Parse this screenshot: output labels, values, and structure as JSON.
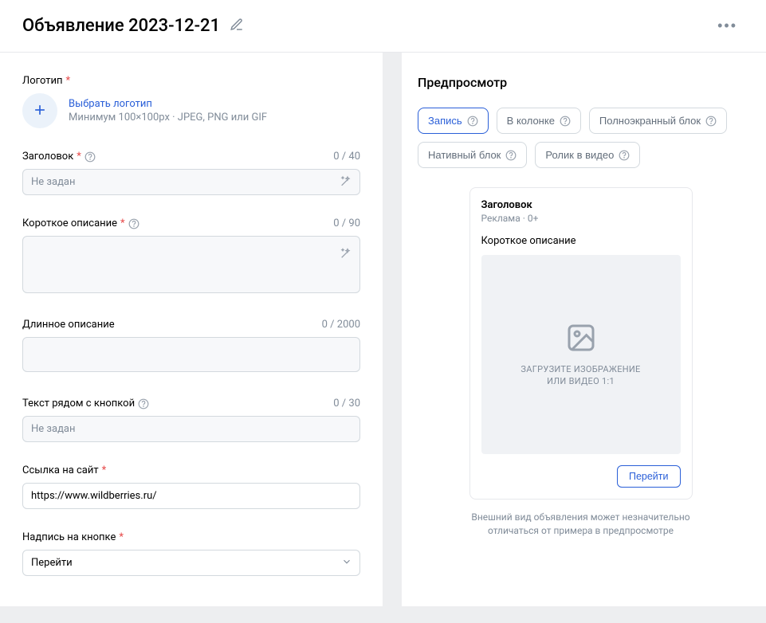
{
  "header": {
    "title": "Объявление 2023-12-21"
  },
  "form": {
    "logo": {
      "label": "Логотип",
      "link_text": "Выбрать логотип",
      "hint": "Минимум 100×100px · JPEG, PNG или GIF"
    },
    "heading": {
      "label": "Заголовок",
      "counter": "0 / 40",
      "placeholder": "Не задан"
    },
    "short_desc": {
      "label": "Короткое описание",
      "counter": "0 / 90"
    },
    "long_desc": {
      "label": "Длинное описание",
      "counter": "0 / 2000"
    },
    "button_text": {
      "label": "Текст рядом с кнопкой",
      "counter": "0 / 30",
      "placeholder": "Не задан"
    },
    "site_link": {
      "label": "Ссылка на сайт",
      "value": "https://www.wildberries.ru/"
    },
    "button_label": {
      "label": "Надпись на кнопке",
      "value": "Перейти"
    }
  },
  "preview": {
    "title": "Предпросмотр",
    "chips": [
      "Запись",
      "В колонке",
      "Полноэкранный блок",
      "Нативный блок",
      "Ролик в видео"
    ],
    "active_chip_index": 0,
    "card": {
      "title": "Заголовок",
      "sub": "Реклама · 0+",
      "desc": "Короткое описание",
      "media_line1": "ЗАГРУЗИТЕ ИЗОБРАЖЕНИЕ",
      "media_line2": "ИЛИ ВИДЕО 1:1",
      "cta": "Перейти"
    },
    "note_line1": "Внешний вид объявления может незначительно",
    "note_line2": "отличаться от примера в предпросмотре"
  }
}
